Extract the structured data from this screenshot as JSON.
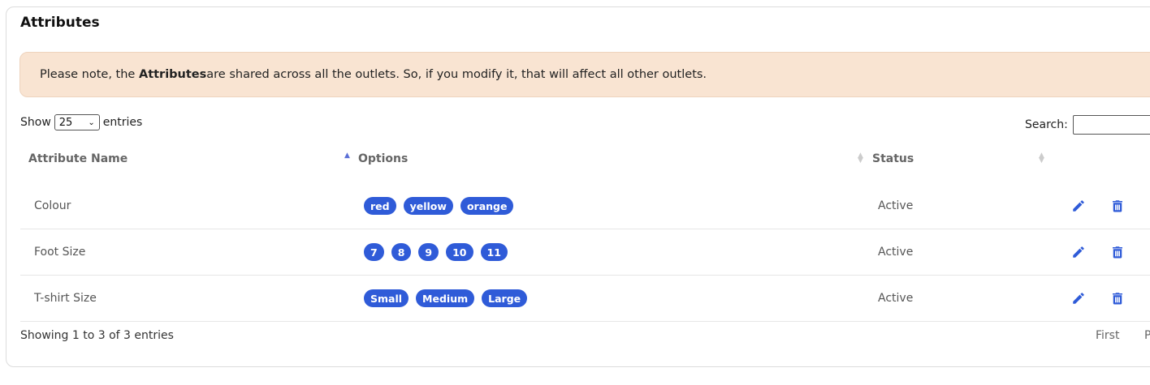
{
  "title": "Attributes",
  "alert": {
    "prefix": "Please note, the ",
    "bold": "Attributes",
    "suffix": " are shared across all the outlets. So, if you modify it, that will affect all other outlets."
  },
  "length_menu": {
    "show_label": "Show",
    "selected": "25",
    "entries_label": "entries"
  },
  "search": {
    "label": "Search:",
    "value": ""
  },
  "columns": [
    "Attribute Name",
    "Options",
    "Status"
  ],
  "rows": [
    {
      "name": "Colour",
      "options": [
        "red",
        "yellow",
        "orange"
      ],
      "status": "Active"
    },
    {
      "name": "Foot Size",
      "options": [
        "7",
        "8",
        "9",
        "10",
        "11"
      ],
      "status": "Active"
    },
    {
      "name": "T-shirt Size",
      "options": [
        "Small",
        "Medium",
        "Large"
      ],
      "status": "Active"
    }
  ],
  "footer": {
    "info": "Showing 1 to 3 of 3 entries"
  },
  "pagination": {
    "first": "First",
    "previous_partial": "P"
  },
  "colors": {
    "badge": "#2f5bd8",
    "alert_bg": "#f9e4d2",
    "icon": "#2f5bd8"
  },
  "icons": {
    "edit": "pencil-icon",
    "delete": "trash-icon",
    "sort": "sort-icon"
  }
}
